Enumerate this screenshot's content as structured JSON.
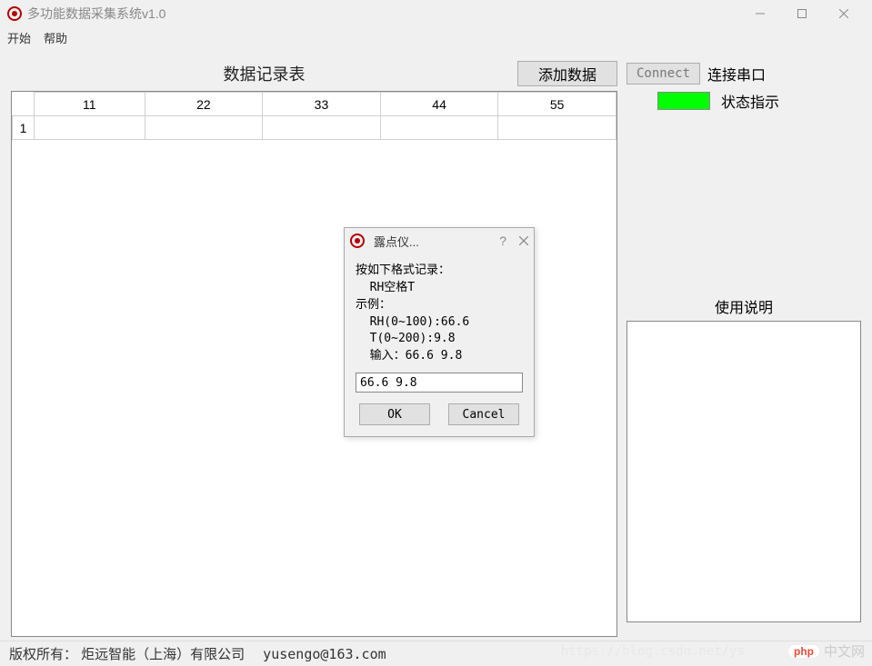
{
  "window": {
    "title": "多功能数据采集系统v1.0"
  },
  "menu": {
    "start": "开始",
    "help": "帮助"
  },
  "main": {
    "table_title": "数据记录表",
    "add_button": "添加数据",
    "columns": [
      "11",
      "22",
      "33",
      "44",
      "55"
    ],
    "rows": [
      {
        "index": "1",
        "cells": [
          "",
          "",
          "",
          "",
          ""
        ]
      }
    ]
  },
  "side": {
    "connect_button": "Connect",
    "connect_label": "连接串口",
    "status_color": "#00ff00",
    "status_label": "状态指示",
    "usage_title": "使用说明"
  },
  "statusbar": {
    "copyright": "版权所有：  炬远智能（上海）有限公司",
    "email": "yusengo@163.com"
  },
  "dialog": {
    "title": "露点仪...",
    "body": "按如下格式记录：\n  RH空格T\n示例：\n  RH(0~100):66.6\n  T(0~200):9.8\n  输入：66.6 9.8",
    "input_value": "66.6 9.8",
    "ok": "OK",
    "cancel": "Cancel"
  },
  "watermark": {
    "url": "https://blog.csdn.net/ys",
    "badge": "php",
    "text": "中文网"
  }
}
